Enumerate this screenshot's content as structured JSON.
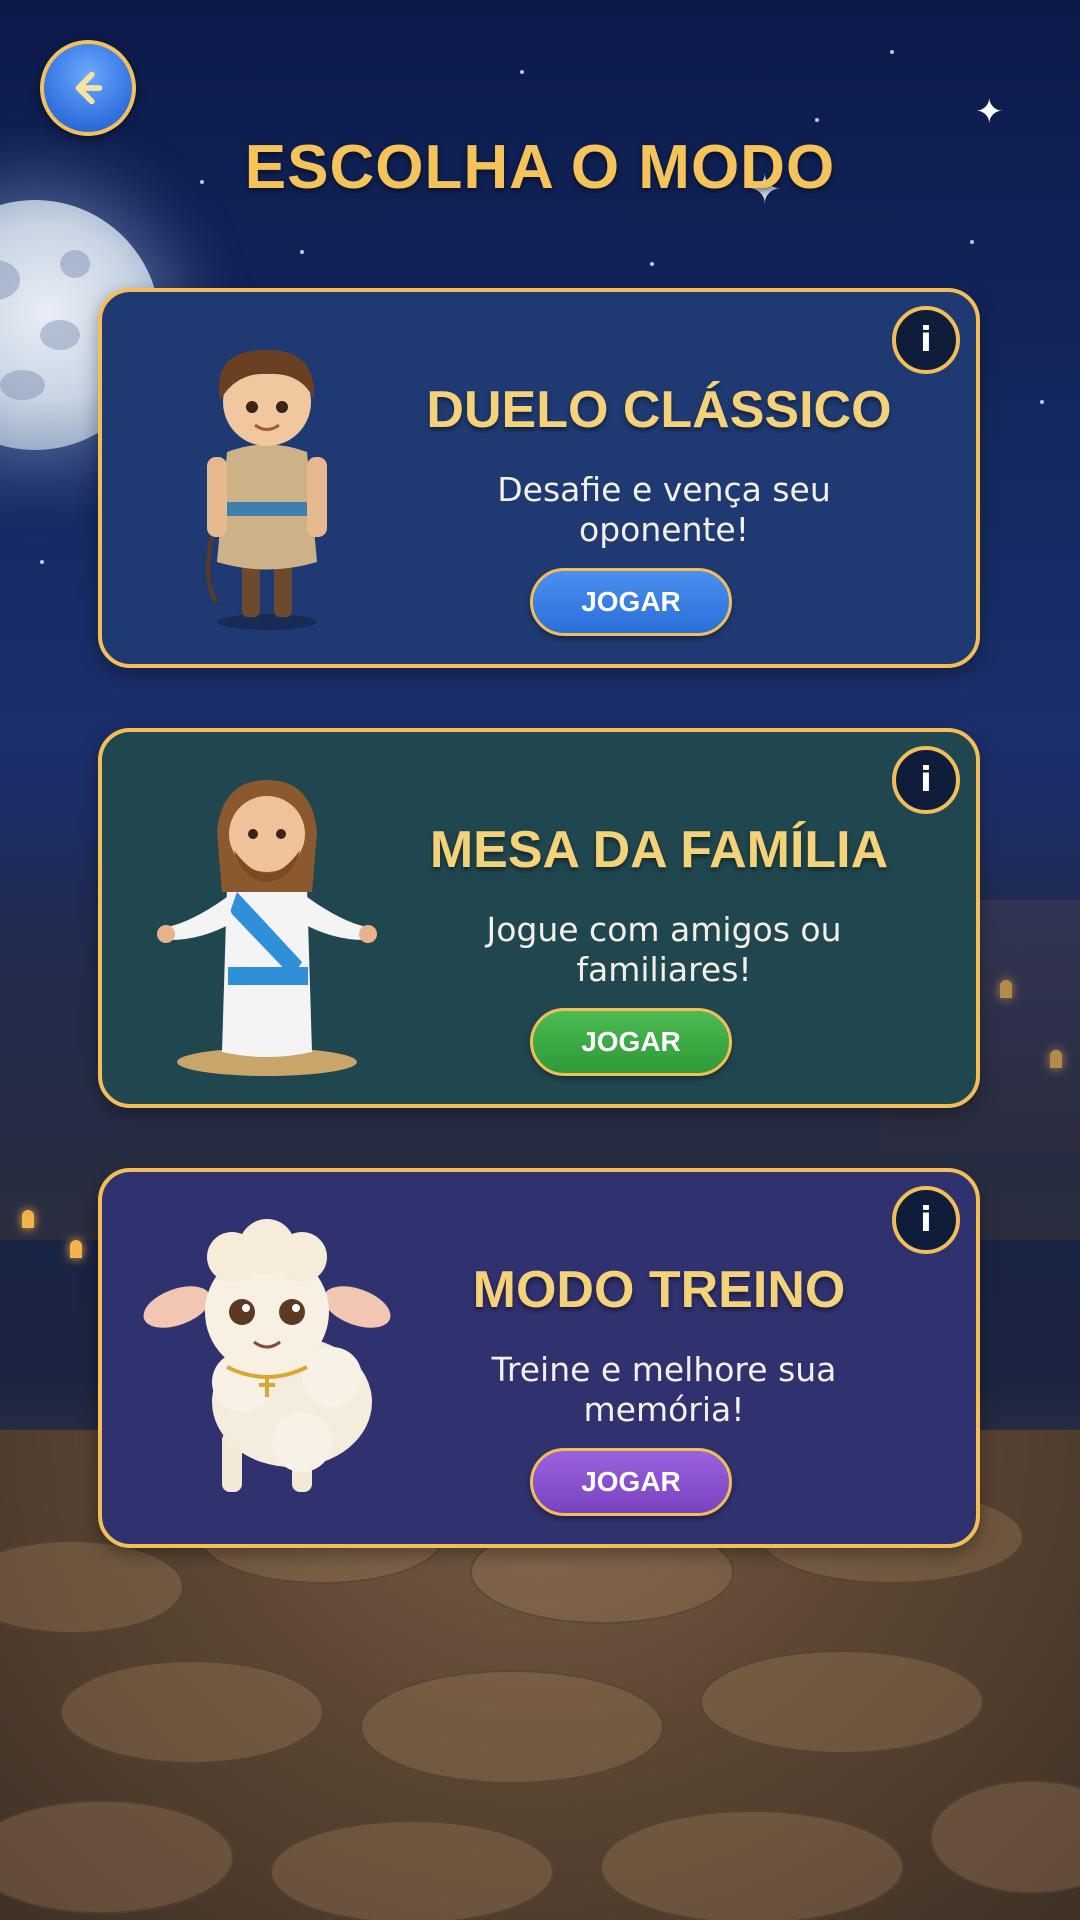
{
  "header": {
    "back_icon": "arrow-left-icon",
    "title": "ESCOLHA O MODO"
  },
  "modes": [
    {
      "title": "DUELO CLÁSSICO",
      "description": "Desafie e vença seu oponente!",
      "button": "JOGAR",
      "info": "i",
      "button_color": "#2f78e0",
      "card_color": "#1f3a72",
      "character": "boy-with-sling"
    },
    {
      "title": "MESA DA FAMÍLIA",
      "description": "Jogue com amigos ou familiares!",
      "button": "JOGAR",
      "info": "i",
      "button_color": "#3aa844",
      "card_color": "#20474f",
      "character": "jesus-open-arms"
    },
    {
      "title": "MODO TREINO",
      "description": "Treine e melhore sua memória!",
      "button": "JOGAR",
      "info": "i",
      "button_color": "#8a52d0",
      "card_color": "#30316f",
      "character": "lamb"
    }
  ],
  "colors": {
    "accent_gold": "#f4c45a",
    "border_gold": "#f1be57"
  }
}
